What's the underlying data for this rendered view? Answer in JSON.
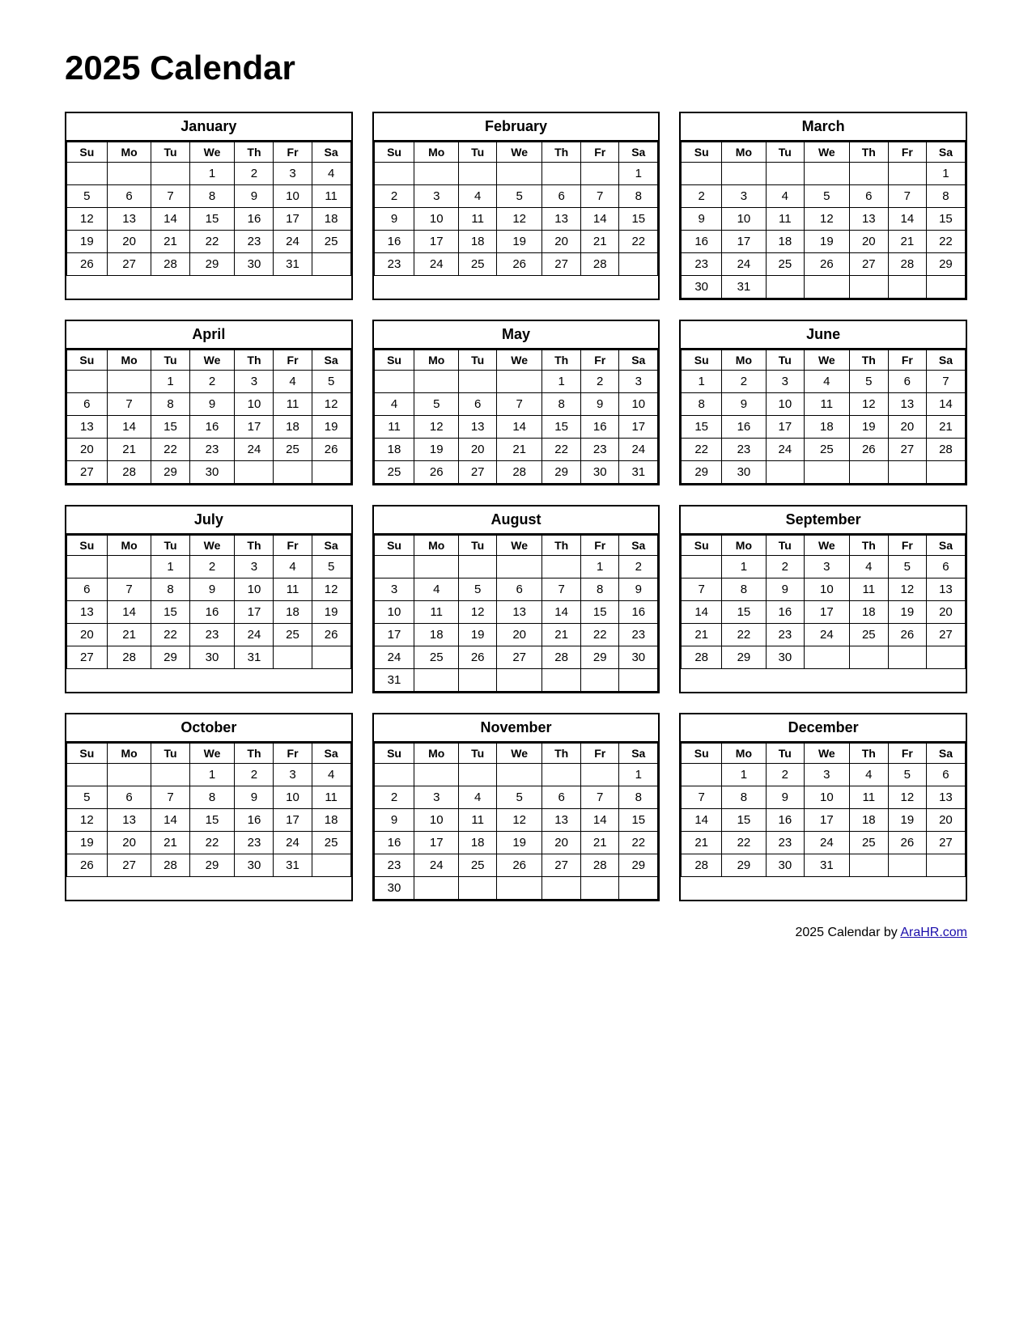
{
  "title": "2025 Calendar",
  "footer": {
    "text": "2025  Calendar by ",
    "link_text": "AraHR.com",
    "link_url": "https://AraHR.com"
  },
  "days_header": [
    "Su",
    "Mo",
    "Tu",
    "We",
    "Th",
    "Fr",
    "Sa"
  ],
  "months": [
    {
      "name": "January",
      "weeks": [
        [
          "",
          "",
          "",
          "1",
          "2",
          "3",
          "4"
        ],
        [
          "5",
          "6",
          "7",
          "8",
          "9",
          "10",
          "11"
        ],
        [
          "12",
          "13",
          "14",
          "15",
          "16",
          "17",
          "18"
        ],
        [
          "19",
          "20",
          "21",
          "22",
          "23",
          "24",
          "25"
        ],
        [
          "26",
          "27",
          "28",
          "29",
          "30",
          "31",
          ""
        ]
      ]
    },
    {
      "name": "February",
      "weeks": [
        [
          "",
          "",
          "",
          "",
          "",
          "",
          "1"
        ],
        [
          "2",
          "3",
          "4",
          "5",
          "6",
          "7",
          "8"
        ],
        [
          "9",
          "10",
          "11",
          "12",
          "13",
          "14",
          "15"
        ],
        [
          "16",
          "17",
          "18",
          "19",
          "20",
          "21",
          "22"
        ],
        [
          "23",
          "24",
          "25",
          "26",
          "27",
          "28",
          ""
        ]
      ]
    },
    {
      "name": "March",
      "weeks": [
        [
          "",
          "",
          "",
          "",
          "",
          "",
          "1"
        ],
        [
          "2",
          "3",
          "4",
          "5",
          "6",
          "7",
          "8"
        ],
        [
          "9",
          "10",
          "11",
          "12",
          "13",
          "14",
          "15"
        ],
        [
          "16",
          "17",
          "18",
          "19",
          "20",
          "21",
          "22"
        ],
        [
          "23",
          "24",
          "25",
          "26",
          "27",
          "28",
          "29"
        ],
        [
          "30",
          "31",
          "",
          "",
          "",
          "",
          ""
        ]
      ]
    },
    {
      "name": "April",
      "weeks": [
        [
          "",
          "",
          "1",
          "2",
          "3",
          "4",
          "5"
        ],
        [
          "6",
          "7",
          "8",
          "9",
          "10",
          "11",
          "12"
        ],
        [
          "13",
          "14",
          "15",
          "16",
          "17",
          "18",
          "19"
        ],
        [
          "20",
          "21",
          "22",
          "23",
          "24",
          "25",
          "26"
        ],
        [
          "27",
          "28",
          "29",
          "30",
          "",
          "",
          ""
        ]
      ]
    },
    {
      "name": "May",
      "weeks": [
        [
          "",
          "",
          "",
          "",
          "1",
          "2",
          "3"
        ],
        [
          "4",
          "5",
          "6",
          "7",
          "8",
          "9",
          "10"
        ],
        [
          "11",
          "12",
          "13",
          "14",
          "15",
          "16",
          "17"
        ],
        [
          "18",
          "19",
          "20",
          "21",
          "22",
          "23",
          "24"
        ],
        [
          "25",
          "26",
          "27",
          "28",
          "29",
          "30",
          "31"
        ]
      ]
    },
    {
      "name": "June",
      "weeks": [
        [
          "1",
          "2",
          "3",
          "4",
          "5",
          "6",
          "7"
        ],
        [
          "8",
          "9",
          "10",
          "11",
          "12",
          "13",
          "14"
        ],
        [
          "15",
          "16",
          "17",
          "18",
          "19",
          "20",
          "21"
        ],
        [
          "22",
          "23",
          "24",
          "25",
          "26",
          "27",
          "28"
        ],
        [
          "29",
          "30",
          "",
          "",
          "",
          "",
          ""
        ]
      ]
    },
    {
      "name": "July",
      "weeks": [
        [
          "",
          "",
          "1",
          "2",
          "3",
          "4",
          "5"
        ],
        [
          "6",
          "7",
          "8",
          "9",
          "10",
          "11",
          "12"
        ],
        [
          "13",
          "14",
          "15",
          "16",
          "17",
          "18",
          "19"
        ],
        [
          "20",
          "21",
          "22",
          "23",
          "24",
          "25",
          "26"
        ],
        [
          "27",
          "28",
          "29",
          "30",
          "31",
          "",
          ""
        ]
      ]
    },
    {
      "name": "August",
      "weeks": [
        [
          "",
          "",
          "",
          "",
          "",
          "1",
          "2"
        ],
        [
          "3",
          "4",
          "5",
          "6",
          "7",
          "8",
          "9"
        ],
        [
          "10",
          "11",
          "12",
          "13",
          "14",
          "15",
          "16"
        ],
        [
          "17",
          "18",
          "19",
          "20",
          "21",
          "22",
          "23"
        ],
        [
          "24",
          "25",
          "26",
          "27",
          "28",
          "29",
          "30"
        ],
        [
          "31",
          "",
          "",
          "",
          "",
          "",
          ""
        ]
      ]
    },
    {
      "name": "September",
      "weeks": [
        [
          "",
          "1",
          "2",
          "3",
          "4",
          "5",
          "6"
        ],
        [
          "7",
          "8",
          "9",
          "10",
          "11",
          "12",
          "13"
        ],
        [
          "14",
          "15",
          "16",
          "17",
          "18",
          "19",
          "20"
        ],
        [
          "21",
          "22",
          "23",
          "24",
          "25",
          "26",
          "27"
        ],
        [
          "28",
          "29",
          "30",
          "",
          "",
          "",
          ""
        ]
      ]
    },
    {
      "name": "October",
      "weeks": [
        [
          "",
          "",
          "",
          "1",
          "2",
          "3",
          "4"
        ],
        [
          "5",
          "6",
          "7",
          "8",
          "9",
          "10",
          "11"
        ],
        [
          "12",
          "13",
          "14",
          "15",
          "16",
          "17",
          "18"
        ],
        [
          "19",
          "20",
          "21",
          "22",
          "23",
          "24",
          "25"
        ],
        [
          "26",
          "27",
          "28",
          "29",
          "30",
          "31",
          ""
        ]
      ]
    },
    {
      "name": "November",
      "weeks": [
        [
          "",
          "",
          "",
          "",
          "",
          "",
          "1"
        ],
        [
          "2",
          "3",
          "4",
          "5",
          "6",
          "7",
          "8"
        ],
        [
          "9",
          "10",
          "11",
          "12",
          "13",
          "14",
          "15"
        ],
        [
          "16",
          "17",
          "18",
          "19",
          "20",
          "21",
          "22"
        ],
        [
          "23",
          "24",
          "25",
          "26",
          "27",
          "28",
          "29"
        ],
        [
          "30",
          "",
          "",
          "",
          "",
          "",
          ""
        ]
      ]
    },
    {
      "name": "December",
      "weeks": [
        [
          "",
          "1",
          "2",
          "3",
          "4",
          "5",
          "6"
        ],
        [
          "7",
          "8",
          "9",
          "10",
          "11",
          "12",
          "13"
        ],
        [
          "14",
          "15",
          "16",
          "17",
          "18",
          "19",
          "20"
        ],
        [
          "21",
          "22",
          "23",
          "24",
          "25",
          "26",
          "27"
        ],
        [
          "28",
          "29",
          "30",
          "31",
          "",
          "",
          ""
        ]
      ]
    }
  ]
}
